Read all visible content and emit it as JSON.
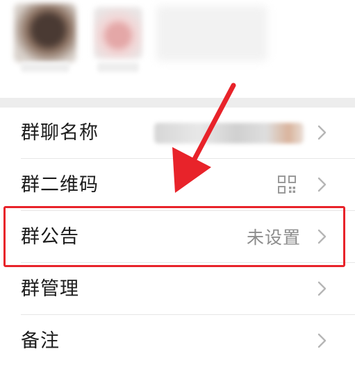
{
  "rows": [
    {
      "label": "群聊名称",
      "value": ""
    },
    {
      "label": "群二维码",
      "value": ""
    },
    {
      "label": "群公告",
      "value": "未设置"
    },
    {
      "label": "群管理",
      "value": ""
    },
    {
      "label": "备注",
      "value": ""
    }
  ],
  "icons": {
    "chevron": "chevron-right-icon",
    "qr": "qr-code-icon"
  },
  "colors": {
    "highlight": "#e8232a",
    "arrow": "#e8232a",
    "label_text": "#1c1c1c",
    "value_text": "#8c8c8c",
    "separator": "#ededed"
  }
}
